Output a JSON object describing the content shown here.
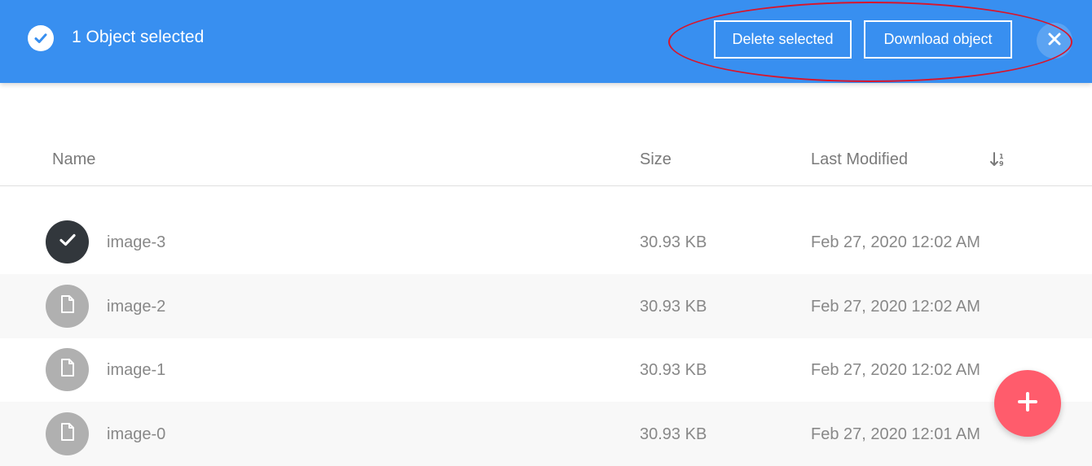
{
  "selection_bar": {
    "status_text": "1 Object selected",
    "delete_label": "Delete selected",
    "download_label": "Download object",
    "bar_color": "#388ff0",
    "icons": {
      "status": "check-circle-icon",
      "close": "close-icon"
    }
  },
  "table": {
    "columns": [
      "Name",
      "Size",
      "Last Modified"
    ],
    "sort_icon": "sort-icon",
    "rows": [
      {
        "name": "image-3",
        "size": "30.93 KB",
        "modified": "Feb 27, 2020 12:02 AM",
        "selected": true
      },
      {
        "name": "image-2",
        "size": "30.93 KB",
        "modified": "Feb 27, 2020 12:02 AM",
        "selected": false
      },
      {
        "name": "image-1",
        "size": "30.93 KB",
        "modified": "Feb 27, 2020 12:02 AM",
        "selected": false
      },
      {
        "name": "image-0",
        "size": "30.93 KB",
        "modified": "Feb 27, 2020 12:01 AM",
        "selected": false
      }
    ]
  },
  "fab": {
    "icon": "plus-icon",
    "color": "#ff5c6c"
  },
  "annotation": {
    "color": "#d9152b"
  }
}
